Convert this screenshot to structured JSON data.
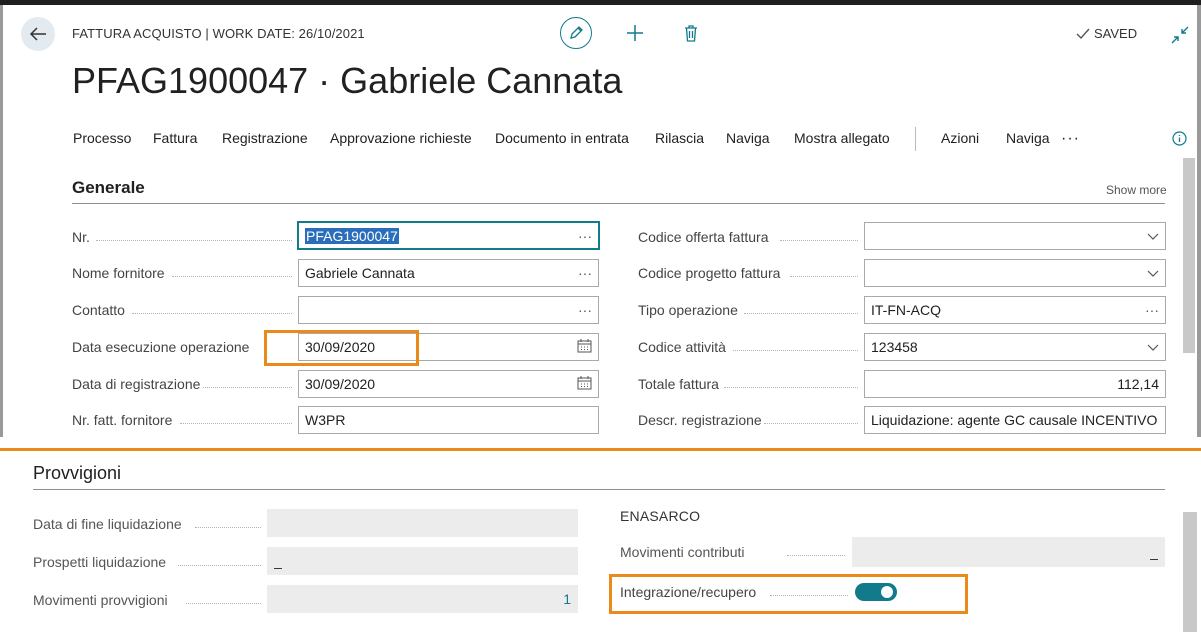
{
  "header": {
    "breadcrumb": "FATTURA ACQUISTO | WORK DATE: 26/10/2021",
    "status": "SAVED",
    "title": "PFAG1900047 · Gabriele Cannata"
  },
  "menu": {
    "items": [
      "Processo",
      "Fattura",
      "Registrazione",
      "Approvazione richieste",
      "Documento in entrata",
      "Rilascia",
      "Naviga",
      "Mostra allegato",
      "Azioni",
      "Naviga"
    ],
    "more": "···"
  },
  "generale": {
    "title": "Generale",
    "show_more": "Show more",
    "left": [
      {
        "label": "Nr.",
        "value": "PFAG1900047"
      },
      {
        "label": "Nome fornitore",
        "value": "Gabriele Cannata"
      },
      {
        "label": "Contatto",
        "value": ""
      },
      {
        "label": "Data esecuzione operazione",
        "value": "30/09/2020"
      },
      {
        "label": "Data di registrazione",
        "value": "30/09/2020"
      },
      {
        "label": "Nr. fatt. fornitore",
        "value": "W3PR"
      }
    ],
    "right": [
      {
        "label": "Codice offerta fattura",
        "value": ""
      },
      {
        "label": "Codice progetto fattura",
        "value": ""
      },
      {
        "label": "Tipo operazione",
        "value": "IT-FN-ACQ"
      },
      {
        "label": "Codice attività",
        "value": "123458"
      },
      {
        "label": "Totale fattura",
        "value": "112,14"
      },
      {
        "label": "Descr. registrazione",
        "value": "Liquidazione: agente GC causale INCENTIVO alla"
      }
    ]
  },
  "provvigioni": {
    "title": "Provvigioni",
    "left": [
      {
        "label": "Data di fine liquidazione",
        "value": ""
      },
      {
        "label": "Prospetti liquidazione",
        "value": "_"
      },
      {
        "label": "Movimenti provvigioni",
        "value": "1"
      }
    ],
    "enasarco": {
      "title": "ENASARCO",
      "movimenti_label": "Movimenti contributi",
      "movimenti_value": "_",
      "integrazione_label": "Integrazione/recupero",
      "integrazione_on": true
    }
  },
  "icons": {
    "back": "arrow-left-icon",
    "edit": "pencil-icon",
    "new": "plus-icon",
    "delete": "trash-icon",
    "saved": "checkmark-icon",
    "collapse": "collapse-icon",
    "info": "info-icon",
    "lookup": "ellipsis-icon",
    "dropdown": "chevron-down-icon",
    "calendar": "calendar-icon"
  },
  "colors": {
    "accent": "#117a8b",
    "highlight": "#e88b1a"
  }
}
